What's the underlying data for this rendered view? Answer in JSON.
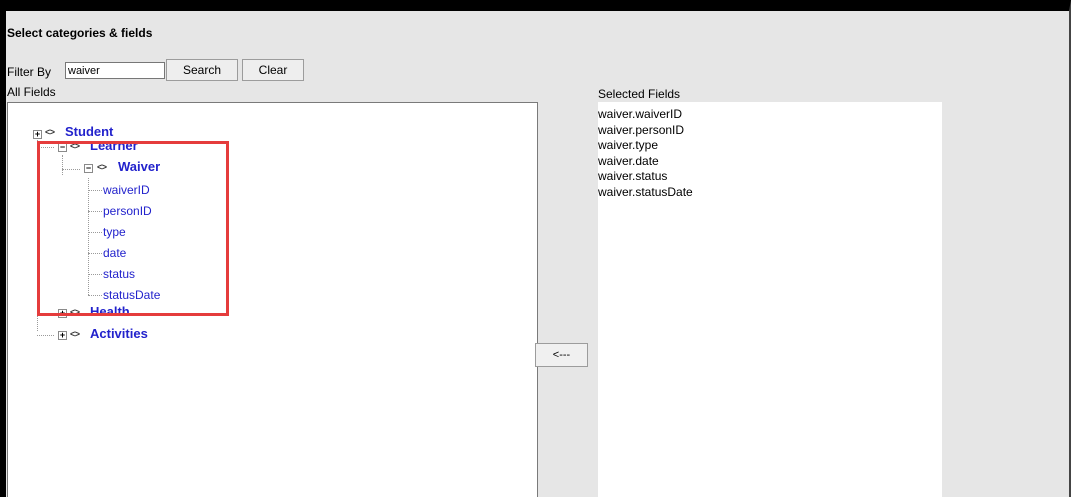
{
  "header": {
    "title": "Select categories & fields"
  },
  "filter": {
    "label": "Filter By",
    "value": "waiver",
    "search_label": "Search",
    "clear_label": "Clear"
  },
  "all_fields": {
    "label": "All Fields",
    "tree": {
      "student": "Student",
      "learner": "Learner",
      "waiver": "Waiver",
      "leaves": [
        "waiverID",
        "personID",
        "type",
        "date",
        "status",
        "statusDate"
      ],
      "health": "Health",
      "activities": "Activities"
    },
    "expander_collapsed": "+",
    "expander_expanded": "−",
    "node_tag": "<>"
  },
  "selected_fields": {
    "label": "Selected Fields",
    "items": [
      "waiver.waiverID",
      "waiver.personID",
      "waiver.type",
      "waiver.date",
      "waiver.status",
      "waiver.statusDate"
    ]
  },
  "move_button": {
    "label": "<---"
  },
  "colors": {
    "link": "#2222cc",
    "highlight": "#e53c3c",
    "panel": "#e6e6e6"
  }
}
